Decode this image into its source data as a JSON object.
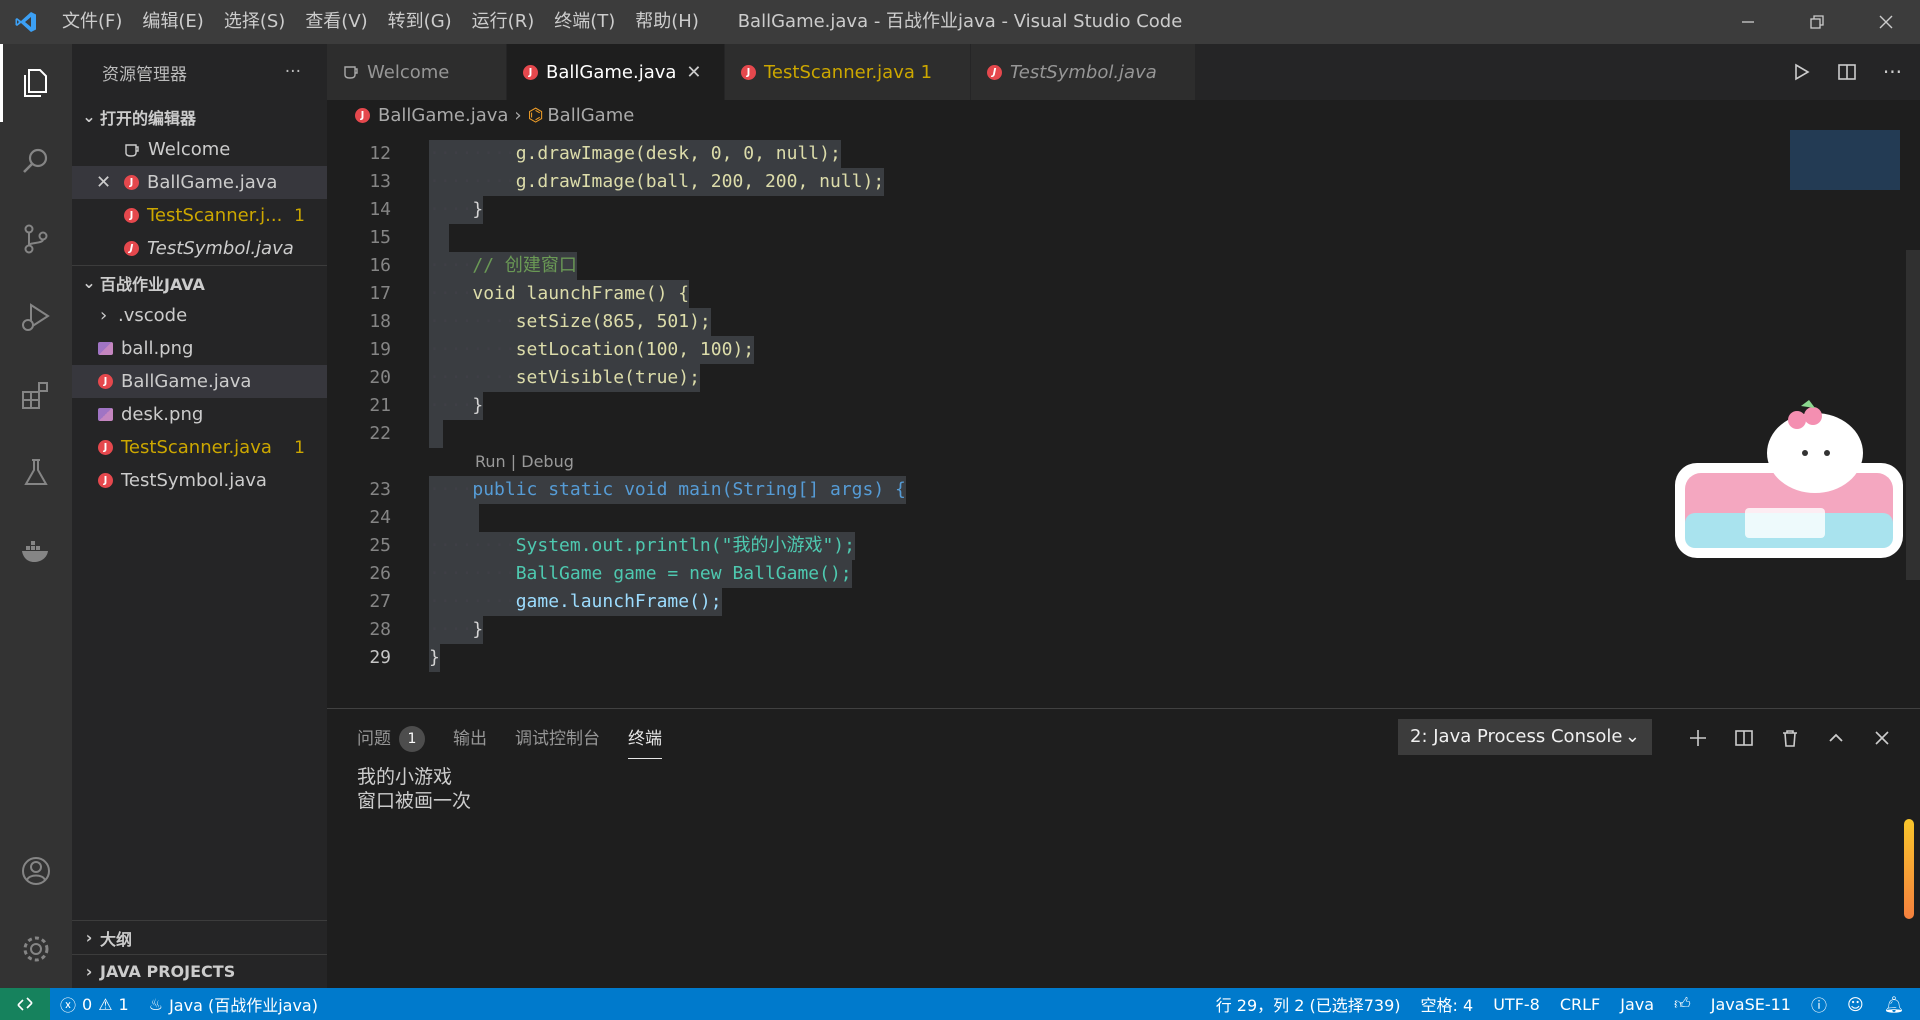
{
  "window": {
    "title": "BallGame.java - 百战作业java - Visual Studio Code",
    "menu": [
      "文件(F)",
      "编辑(E)",
      "选择(S)",
      "查看(V)",
      "转到(G)",
      "运行(R)",
      "终端(T)",
      "帮助(H)"
    ]
  },
  "sidebar": {
    "title": "资源管理器",
    "open_editors_title": "打开的编辑器",
    "open_editors": [
      {
        "label": "Welcome"
      },
      {
        "label": "BallGame.java"
      },
      {
        "label": "TestScanner.j...",
        "badge": "1"
      },
      {
        "label": "TestSymbol.java"
      }
    ],
    "workspace_title": "百战作业JAVA",
    "files": [
      {
        "label": ".vscode"
      },
      {
        "label": "ball.png"
      },
      {
        "label": "BallGame.java"
      },
      {
        "label": "desk.png"
      },
      {
        "label": "TestScanner.java",
        "badge": "1"
      },
      {
        "label": "TestSymbol.java"
      }
    ],
    "outline_title": "大纲",
    "java_projects_title": "JAVA PROJECTS"
  },
  "tabs": [
    {
      "label": "Welcome"
    },
    {
      "label": "BallGame.java"
    },
    {
      "label": "TestScanner.java 1"
    },
    {
      "label": "TestSymbol.java"
    }
  ],
  "breadcrumb": {
    "file": "BallGame.java",
    "symbol": "BallGame"
  },
  "editor": {
    "line_numbers": [
      "12",
      "13",
      "14",
      "15",
      "16",
      "17",
      "18",
      "19",
      "20",
      "21",
      "22",
      "23",
      "24",
      "25",
      "26",
      "27",
      "28",
      "29"
    ],
    "codelens": "Run | Debug",
    "lines": {
      "l12": "g.drawImage(desk, 0, 0, null);",
      "l13": "g.drawImage(ball, 200, 200, null);",
      "l14": "}",
      "l16": "// 创建窗口",
      "l17": "void launchFrame() {",
      "l18": "setSize(865, 501);",
      "l19": "setLocation(100, 100);",
      "l20": "setVisible(true);",
      "l21": "}",
      "l23": "public static void main(String[] args) {",
      "l25": "System.out.println(\"我的小游戏\");",
      "l26": "BallGame game = new BallGame();",
      "l27": "game.launchFrame();",
      "l28": "}",
      "l29": "}"
    }
  },
  "panel": {
    "tabs": [
      {
        "label": "问题",
        "count": "1"
      },
      {
        "label": "输出"
      },
      {
        "label": "调试控制台"
      },
      {
        "label": "终端"
      }
    ],
    "terminal_select": "2: Java Process Console",
    "output": [
      "我的小游戏",
      "窗口被画一次"
    ]
  },
  "statusbar": {
    "errors": "0",
    "warnings": "1",
    "java_project": "Java (百战作业java)",
    "position": "行 29，列 2 (已选择739)",
    "spaces": "空格: 4",
    "encoding": "UTF-8",
    "eol": "CRLF",
    "language": "Java",
    "jdk": "JavaSE-11"
  },
  "colors": {
    "accent": "#007acc",
    "warning": "#cca700",
    "remote": "#16825d"
  }
}
